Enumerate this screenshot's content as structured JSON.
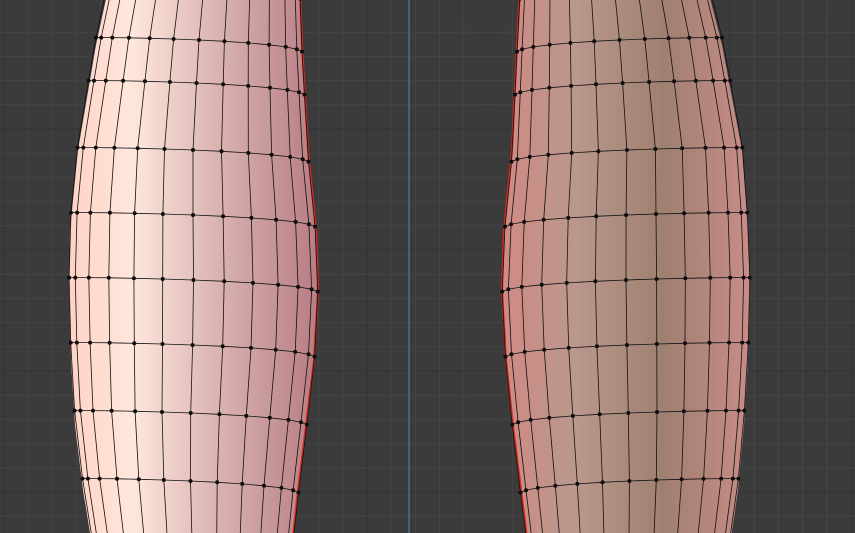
{
  "viewport": {
    "background_color": "#3b3b3b",
    "minor_grid_color": "#454545",
    "major_grid_color": "#333333",
    "axis_color": "#4d6b95"
  },
  "meshes": [
    {
      "name": "left-mesh",
      "state": "selected-edit-mode",
      "highlight_color": "#ffe7dc",
      "shade_color": "#b77d82",
      "outline_color": "#d9281e"
    },
    {
      "name": "right-mesh",
      "state": "selected-edit-mode",
      "highlight_color": "#ac8672",
      "shade_color": "#d08a84",
      "outline_color": "#d9281e"
    }
  ],
  "vertex_color": "#0d0d0d",
  "edge_color": "#111111"
}
